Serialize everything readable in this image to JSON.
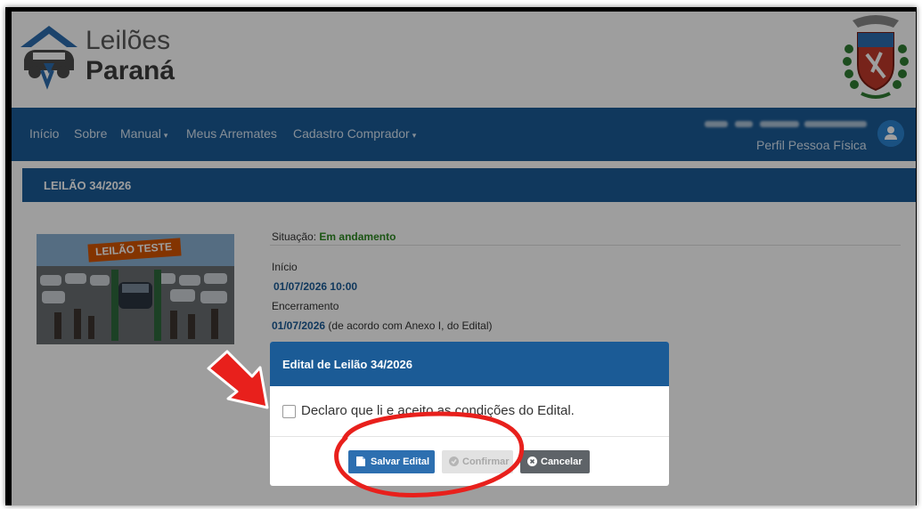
{
  "brand": {
    "line1": "Leilões",
    "line2": "Paraná"
  },
  "nav": {
    "items": [
      {
        "label": "Início"
      },
      {
        "label": "Sobre"
      },
      {
        "label": "Manual",
        "caret": "▾"
      },
      {
        "label": "Meus Arremates"
      },
      {
        "label": "Cadastro Comprador",
        "caret": "▾"
      }
    ],
    "profile_type": "Perfil Pessoa Física",
    "avatar_icon": "user-icon"
  },
  "lot": {
    "title": "LEILÃO 34/2026",
    "photo_banner": "LEILÃO TESTE",
    "status_label": "Situação:",
    "status_value": "Em andamento",
    "start_label": "Início",
    "start_value": "01/07/2026 10:00",
    "end_label": "Encerramento",
    "end_value": "01/07/2026",
    "end_note": "(de acordo com Anexo I, do Edital)"
  },
  "modal": {
    "title": "Edital de Leilão 34/2026",
    "checkbox_label": "Declaro que li e aceito as condições do Edital.",
    "save_label": "Salvar Edital",
    "confirm_label": "Confirmar",
    "cancel_label": "Cancelar"
  },
  "colors": {
    "nav_blue": "#1b5b96",
    "status_green": "#2e8a22",
    "annotation_red": "#e8201c"
  }
}
